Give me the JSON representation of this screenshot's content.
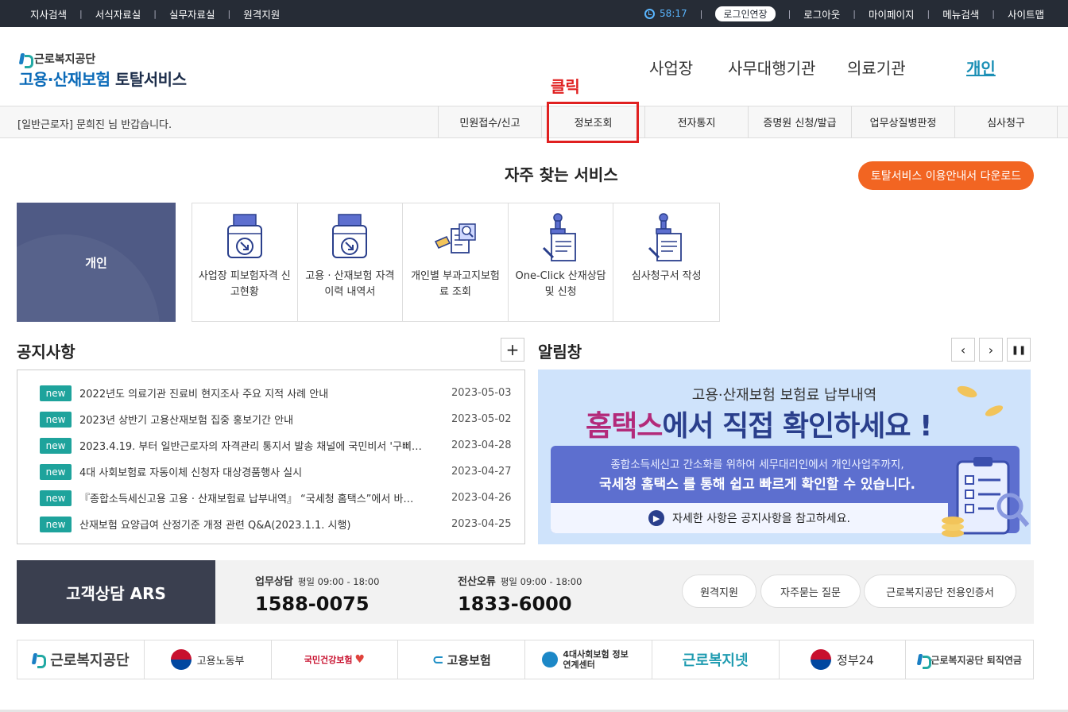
{
  "topbar": {
    "left_links": [
      "지사검색",
      "서식자료실",
      "실무자료실",
      "원격지원"
    ],
    "timer": "58:17",
    "extend_button": "로그인연장",
    "right_links": [
      "로그아웃",
      "마이페이지",
      "메뉴검색",
      "사이트맵"
    ]
  },
  "header": {
    "org_name": "근로복지공단",
    "title_blue": "고용·산재보험",
    "title_dark": "토탈서비스",
    "nav": [
      "사업장",
      "사무대행기관",
      "의료기관",
      "개인"
    ],
    "annotation": "클릭"
  },
  "subbar": {
    "greeting_role": "[일반근로자]",
    "greeting_name": "문희진",
    "greeting_suffix": "님 반갑습니다.",
    "menu": [
      "민원접수/신고",
      "정보조회",
      "전자통지",
      "증명원 신청/발급",
      "업무상질병판정",
      "심사청구"
    ]
  },
  "services": {
    "title": "자주 찾는 서비스",
    "download_button": "토탈서비스 이용안내서 다운로드",
    "category": "개인",
    "tiles": [
      {
        "label": "사업장 피보험자격 신고현황",
        "icon": "printer-arrow-icon"
      },
      {
        "label": "고용 · 산재보험 자격 이력 내역서",
        "icon": "printer-arrow-icon"
      },
      {
        "label": "개인별 부과고지보험료 조회",
        "icon": "document-search-icon"
      },
      {
        "label": "One-Click 산재상담 및 신청",
        "icon": "stamp-document-icon"
      },
      {
        "label": "심사청구서 작성",
        "icon": "stamp-document-icon"
      }
    ]
  },
  "notices": {
    "title": "공지사항",
    "more": "+",
    "badge": "new",
    "items": [
      {
        "text": "2022년도 의료기관 진료비 현지조사 주요 지적 사례 안내",
        "date": "2023-05-03"
      },
      {
        "text": "2023년 상반기 고용산재보험 집중 홍보기간 안내",
        "date": "2023-05-02"
      },
      {
        "text": "2023.4.19. 부터 일반근로자의 자격관리 통지서 발송 채널에 국민비서 '구삐…",
        "date": "2023-04-28"
      },
      {
        "text": "4대 사회보험료 자동이체 신청자 대상경품행사 실시",
        "date": "2023-04-27"
      },
      {
        "text": "『종합소득세신고용 고용 · 산재보험료 납부내역』 “국세청 홈택스”에서 바…",
        "date": "2023-04-26"
      },
      {
        "text": "산재보험 요양급여 산정기준 개정 관련 Q&A(2023.1.1. 시행)",
        "date": "2023-04-25"
      }
    ]
  },
  "alarm": {
    "title": "알림창",
    "prev": "‹",
    "next": "›",
    "pause": "❚❚",
    "banner_line1": "고용·산재보험 보험료 납부내역",
    "banner_highlight": "홈택스",
    "banner_line2": "에서 직접 확인하세요 !",
    "panel_line1": "종합소득세신고 간소화를 위하여 세무대리인에서 개인사업주까지,",
    "panel_line2": "국세청 홈택스 를 통해 쉽고 빠르게 확인할 수 있습니다.",
    "panel_footer": "자세한 사항은 공지사항을 참고하세요."
  },
  "ars": {
    "title": "고객상담 ARS",
    "business_label": "업무상담",
    "business_hours": "평일 09:00 - 18:00",
    "business_number": "1588-0075",
    "error_label": "전산오류",
    "error_hours": "평일 09:00 - 18:00",
    "error_number": "1833-6000",
    "buttons": [
      "원격지원",
      "자주묻는 질문",
      "근로복지공단 전용인증서"
    ]
  },
  "footer_logos": [
    "근로복지공단",
    "고용노동부",
    "국민건강보험",
    "고용보험",
    "4대사회보험 정보연계센터",
    "근로복지넷",
    "정부24",
    "근로복지공단 퇴직연금"
  ],
  "colors": {
    "topbar": "#262c36",
    "accent_orange": "#f26522",
    "new_badge": "#1ea39c",
    "highlight_red": "#e02020",
    "personal_box": "#4f5a85"
  }
}
